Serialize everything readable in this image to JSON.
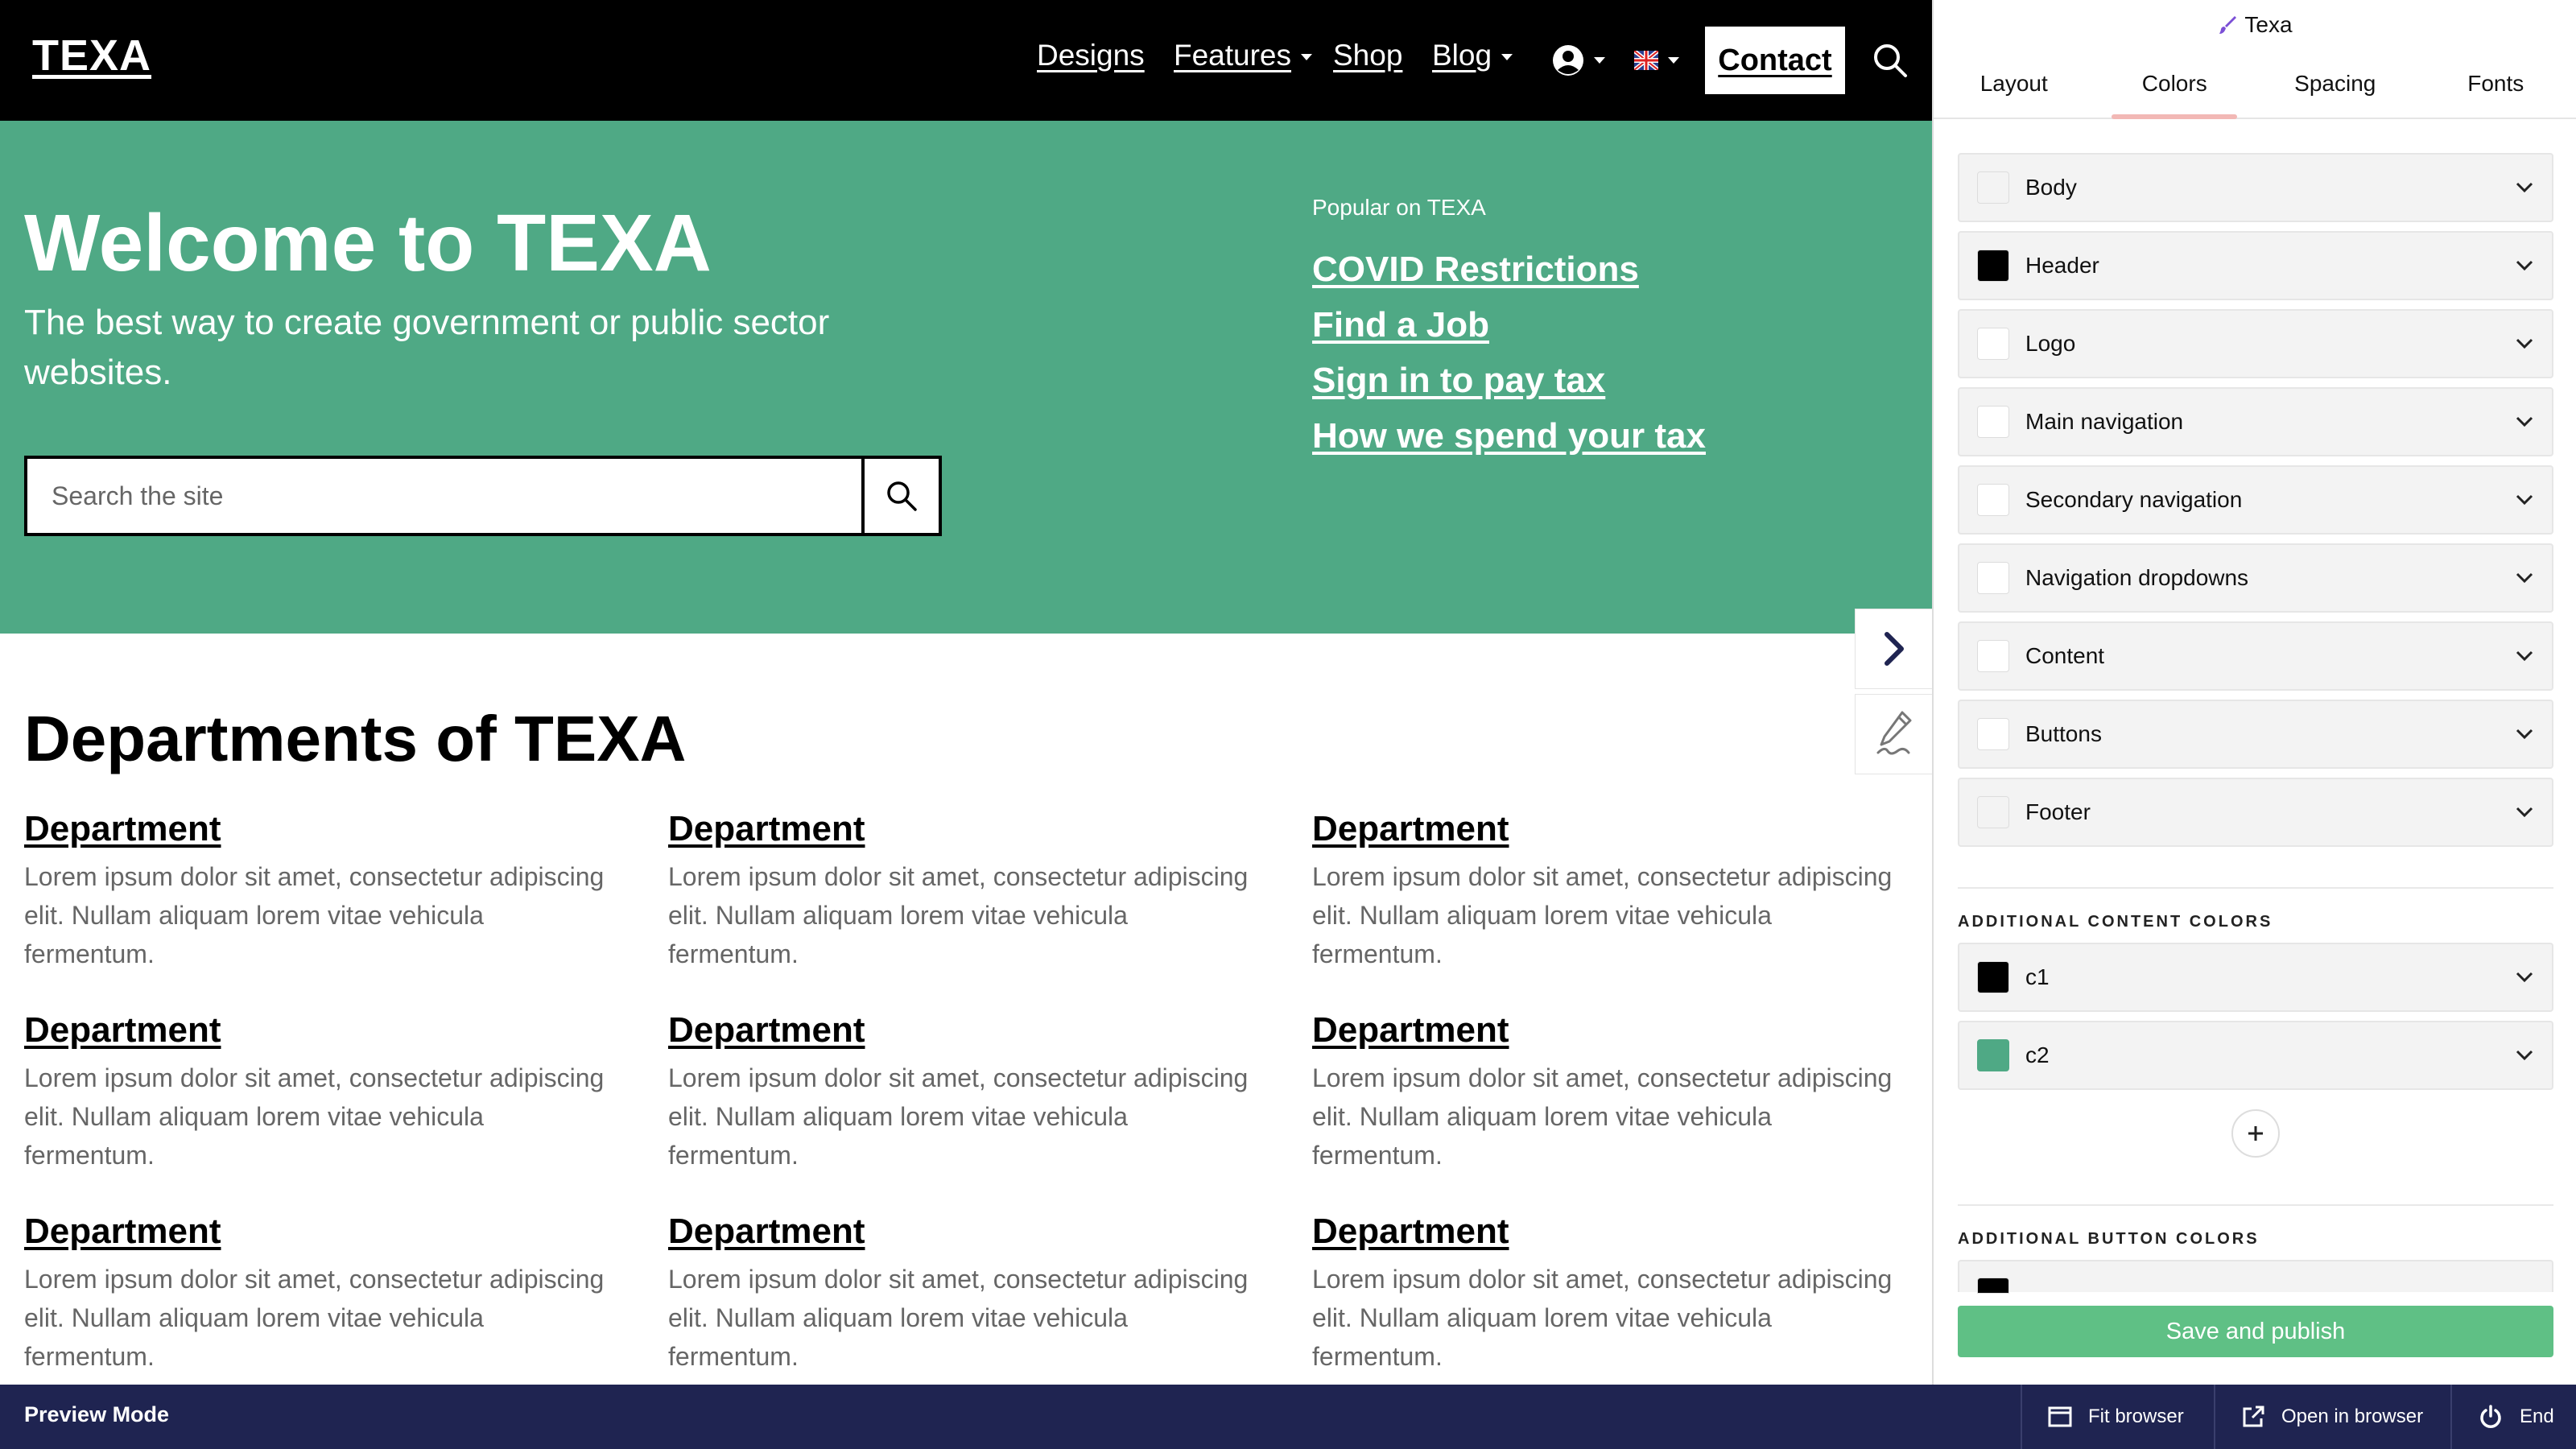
{
  "site": {
    "logo": "TEXA",
    "nav": {
      "designs": "Designs",
      "features": "Features",
      "shop": "Shop",
      "blog": "Blog",
      "contact": "Contact"
    },
    "hero": {
      "title": "Welcome to TEXA",
      "subtitle": "The best way to create government or public sector websites.",
      "search_placeholder": "Search the site",
      "popular_heading": "Popular on TEXA",
      "popular_links": [
        "COVID Restrictions",
        "Find a Job",
        "Sign in to pay tax",
        "How we spend your tax"
      ]
    },
    "departments": {
      "title": "Departments of TEXA",
      "items": [
        {
          "title": "Department",
          "text": "Lorem ipsum dolor sit amet, consectetur adipiscing elit. Nullam aliquam lorem vitae vehicula fermentum."
        },
        {
          "title": "Department",
          "text": "Lorem ipsum dolor sit amet, consectetur adipiscing elit. Nullam aliquam lorem vitae vehicula fermentum."
        },
        {
          "title": "Department",
          "text": "Lorem ipsum dolor sit amet, consectetur adipiscing elit. Nullam aliquam lorem vitae vehicula fermentum."
        },
        {
          "title": "Department",
          "text": "Lorem ipsum dolor sit amet, consectetur adipiscing elit. Nullam aliquam lorem vitae vehicula fermentum."
        },
        {
          "title": "Department",
          "text": "Lorem ipsum dolor sit amet, consectetur adipiscing elit. Nullam aliquam lorem vitae vehicula fermentum."
        },
        {
          "title": "Department",
          "text": "Lorem ipsum dolor sit amet, consectetur adipiscing elit. Nullam aliquam lorem vitae vehicula fermentum."
        },
        {
          "title": "Department",
          "text": "Lorem ipsum dolor sit amet, consectetur adipiscing elit. Nullam aliquam lorem vitae vehicula fermentum."
        },
        {
          "title": "Department",
          "text": "Lorem ipsum dolor sit amet, consectetur adipiscing elit. Nullam aliquam lorem vitae vehicula fermentum."
        },
        {
          "title": "Department",
          "text": "Lorem ipsum dolor sit amet, consectetur adipiscing elit. Nullam aliquam lorem vitae vehicula fermentum."
        }
      ]
    },
    "colors": {
      "header_bg": "#000000",
      "hero_bg": "#4fa985"
    }
  },
  "panel": {
    "title": "Texa",
    "tabs": [
      {
        "label": "Layout",
        "active": false
      },
      {
        "label": "Colors",
        "active": true
      },
      {
        "label": "Spacing",
        "active": false
      },
      {
        "label": "Fonts",
        "active": false
      }
    ],
    "color_groups": [
      {
        "label": "Body",
        "swatch": "#f3f3f3"
      },
      {
        "label": "Header",
        "swatch": "#000000"
      },
      {
        "label": "Logo",
        "swatch": "#ffffff"
      },
      {
        "label": "Main navigation",
        "swatch": "#ffffff"
      },
      {
        "label": "Secondary navigation",
        "swatch": "#ffffff"
      },
      {
        "label": "Navigation dropdowns",
        "swatch": "#ffffff"
      },
      {
        "label": "Content",
        "swatch": "#ffffff"
      },
      {
        "label": "Buttons",
        "swatch": "#ffffff"
      },
      {
        "label": "Footer",
        "swatch": "#f3f3f3"
      }
    ],
    "additional_content_heading": "ADDITIONAL CONTENT COLORS",
    "additional_content_colors": [
      {
        "label": "c1",
        "swatch": "#000000"
      },
      {
        "label": "c2",
        "swatch": "#4fa985"
      }
    ],
    "additional_button_heading": "ADDITIONAL BUTTON COLORS",
    "save_label": "Save and publish",
    "save_color": "#5fc085"
  },
  "preview_bar": {
    "label": "Preview Mode",
    "fit_browser": "Fit browser",
    "open_in_browser": "Open in browser",
    "end": "End",
    "bg": "#1f2451"
  },
  "icons": {
    "search": "search-icon",
    "user": "user-circle-icon",
    "flag": "uk-flag-icon",
    "chevron": "chevron-down-icon",
    "collapse": "chevron-right-icon",
    "edit": "pen-signature-icon",
    "plus": "plus-icon",
    "fit": "window-icon",
    "open": "external-link-icon",
    "power": "power-icon",
    "brush": "brush-icon"
  }
}
